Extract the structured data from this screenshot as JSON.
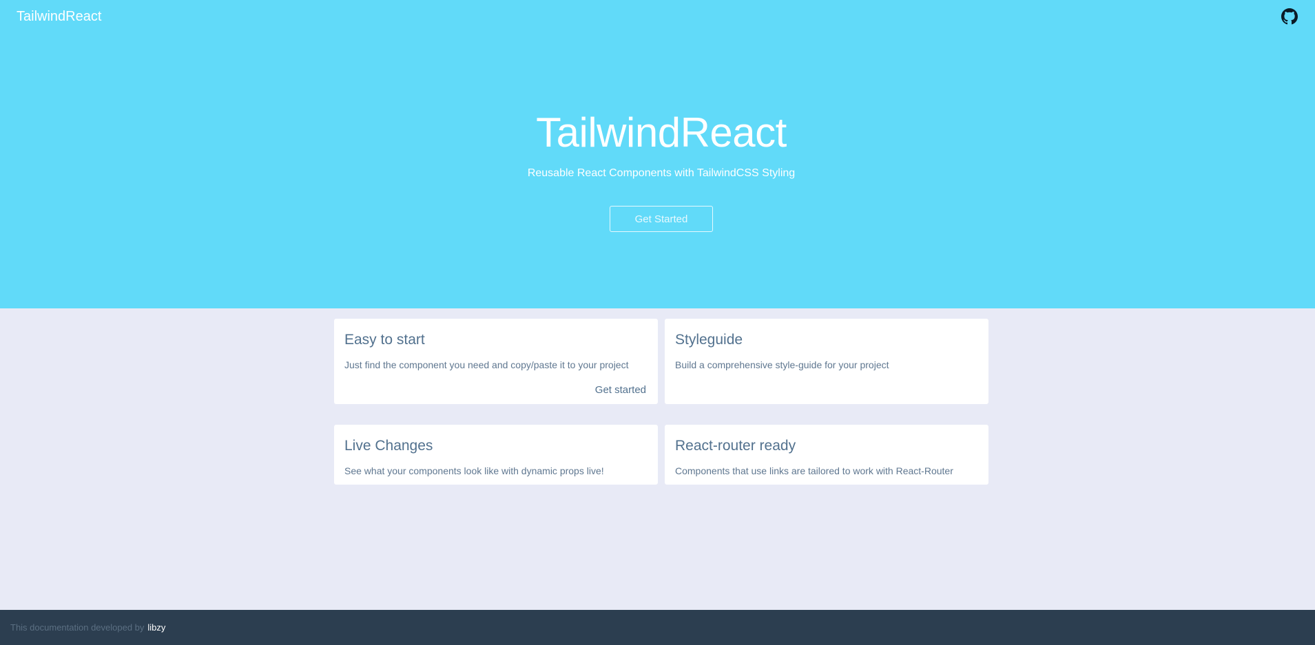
{
  "navbar": {
    "brand": "TailwindReact",
    "github_icon": "github-icon"
  },
  "hero": {
    "title": "TailwindReact",
    "subtitle": "Reusable React Components with TailwindCSS Styling",
    "cta_label": "Get Started"
  },
  "features": [
    {
      "title": "Easy to start",
      "description": "Just find the component you need and copy/paste it to your project",
      "link": "Get started"
    },
    {
      "title": "Styleguide",
      "description": "Build a comprehensive style-guide for your project"
    },
    {
      "title": "Live Changes",
      "description": "See what your components look like with dynamic props live!"
    },
    {
      "title": "React-router ready",
      "description": "Components that use links are tailored to work with React-Router"
    }
  ],
  "footer": {
    "text": "This documentation developed by",
    "author": "libzy"
  },
  "colors": {
    "hero_bg": "#61daf9",
    "page_bg": "#e8eaf6",
    "footer_bg": "#2c3e50",
    "card_heading": "#52718e"
  }
}
